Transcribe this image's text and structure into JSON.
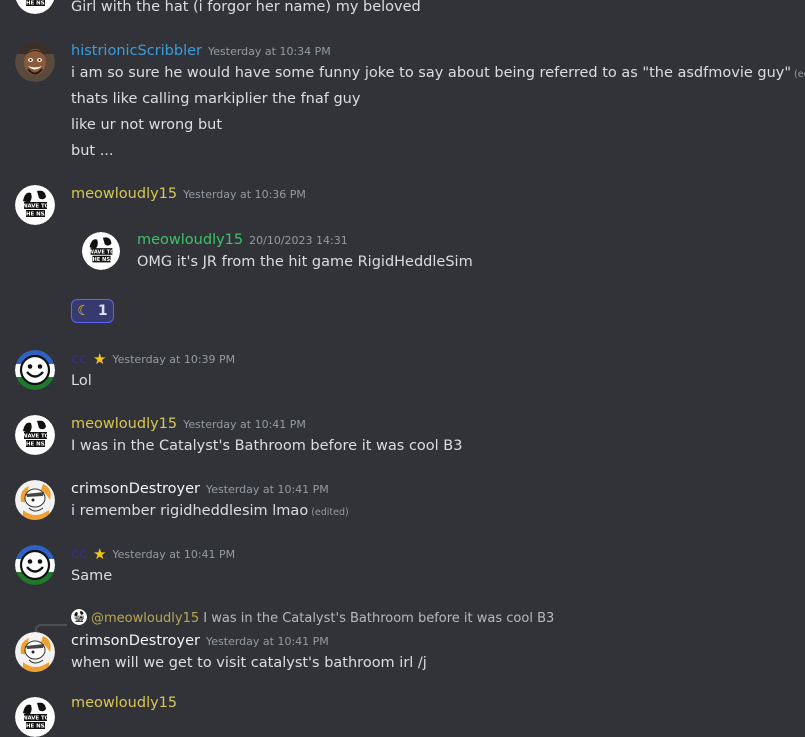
{
  "messages": {
    "m0": {
      "text": "Girl with the hat (i forgor her name) my beloved"
    },
    "m1": {
      "username": "histrionicScribbler",
      "timestamp": "Yesterday at 10:34 PM",
      "lines": [
        "i am so sure he would have some funny joke to say about being referred to as \"the asdfmovie guy\"",
        "thats like calling markiplier the fnaf guy",
        "like ur not wrong but",
        "but ..."
      ],
      "edited": "(edited)"
    },
    "m2": {
      "username": "meowloudly15",
      "timestamp": "Yesterday at 10:36 PM",
      "embed": {
        "username": "meowloudly15",
        "timestamp": "20/10/2023 14:31",
        "text": "OMG it's JR from the hit game RigidHeddleSim"
      },
      "reaction": {
        "emoji": "☾",
        "count": "1"
      }
    },
    "m3": {
      "username": "cc",
      "timestamp": "Yesterday at 10:39 PM",
      "text": "Lol"
    },
    "m4": {
      "username": "meowloudly15",
      "timestamp": "Yesterday at 10:41 PM",
      "text": "I was in the Catalyst's Bathroom before it was cool B3"
    },
    "m5": {
      "username": "crimsonDestroyer",
      "timestamp": "Yesterday at 10:41 PM",
      "text": "i remember rigidheddlesim lmao",
      "edited": "(edited)"
    },
    "m6": {
      "username": "cc",
      "timestamp": "Yesterday at 10:41 PM",
      "text": "Same"
    },
    "m7": {
      "reply_user": "@meowloudly15",
      "reply_text": "I was in the Catalyst's Bathroom before it was cool B3",
      "username": "crimsonDestroyer",
      "timestamp": "Yesterday at 10:41 PM",
      "text": "when will we get to visit catalyst's bathroom irl /j"
    },
    "m8": {
      "username": "meowloudly15"
    }
  },
  "avatar_text": {
    "line1": "WAVE TO",
    "line2": "THE NSA"
  },
  "colors": {
    "background": "#313338",
    "cc_name": "#3f2b87",
    "histrionic_name": "#3a9ee0",
    "meow_name": "#d6c853",
    "embed_name": "#3bc46a",
    "reaction_border": "#5865f2"
  },
  "icons": [
    "wave-to-the-nsa-avatar",
    "portrait-avatar",
    "smiley-flag-avatar",
    "cartoon-character-avatar",
    "star-icon",
    "moon-icon"
  ]
}
